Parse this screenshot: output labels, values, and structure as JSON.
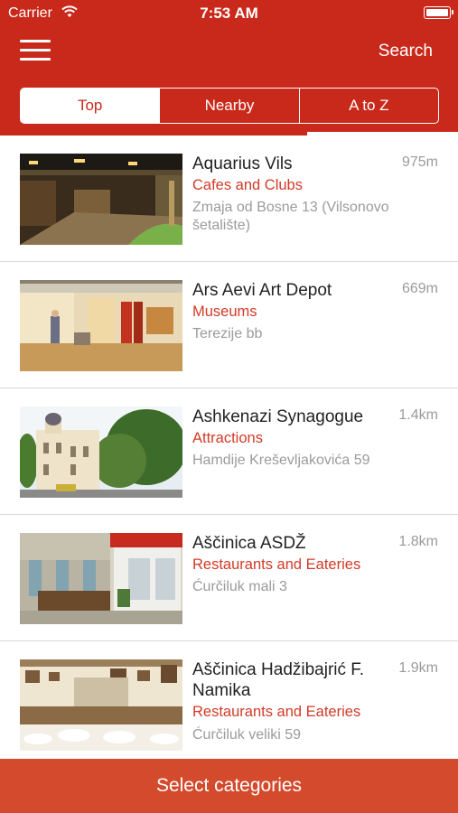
{
  "status_bar": {
    "carrier": "Carrier",
    "time": "7:53 AM",
    "wifi_icon": "wifi-icon",
    "battery_icon": "battery-icon"
  },
  "nav": {
    "menu_icon": "hamburger-menu-icon",
    "search_label": "Search"
  },
  "tabs": [
    {
      "label": "Top",
      "active": true
    },
    {
      "label": "Nearby",
      "active": false
    },
    {
      "label": "A to Z",
      "active": false
    }
  ],
  "places": [
    {
      "name": "Aquarius Vils",
      "category": "Cafes and Clubs",
      "address": "Zmaja od Bosne 13 (Vilsonovo šetalište)",
      "distance": "975m"
    },
    {
      "name": "Ars Aevi Art Depot",
      "category": "Museums",
      "address": "Terezije bb",
      "distance": "669m"
    },
    {
      "name": "Ashkenazi Synagogue",
      "category": "Attractions",
      "address": "Hamdije Kreševljakovića 59",
      "distance": "1.4km"
    },
    {
      "name": "Aščinica ASDŽ",
      "category": "Restaurants and Eateries",
      "address": "Ćurčiluk mali 3",
      "distance": "1.8km"
    },
    {
      "name": "Aščinica Hadžibajrić F. Namika",
      "category": "Restaurants and Eateries",
      "address": "Ćurčiluk veliki  59",
      "distance": "1.9km"
    }
  ],
  "bottom_button": {
    "label": "Select categories"
  },
  "colors": {
    "brand_red": "#c9291b",
    "category_red": "#d33a27",
    "bottom_bar": "#d34a2c",
    "secondary_text": "#9b9b9b"
  }
}
